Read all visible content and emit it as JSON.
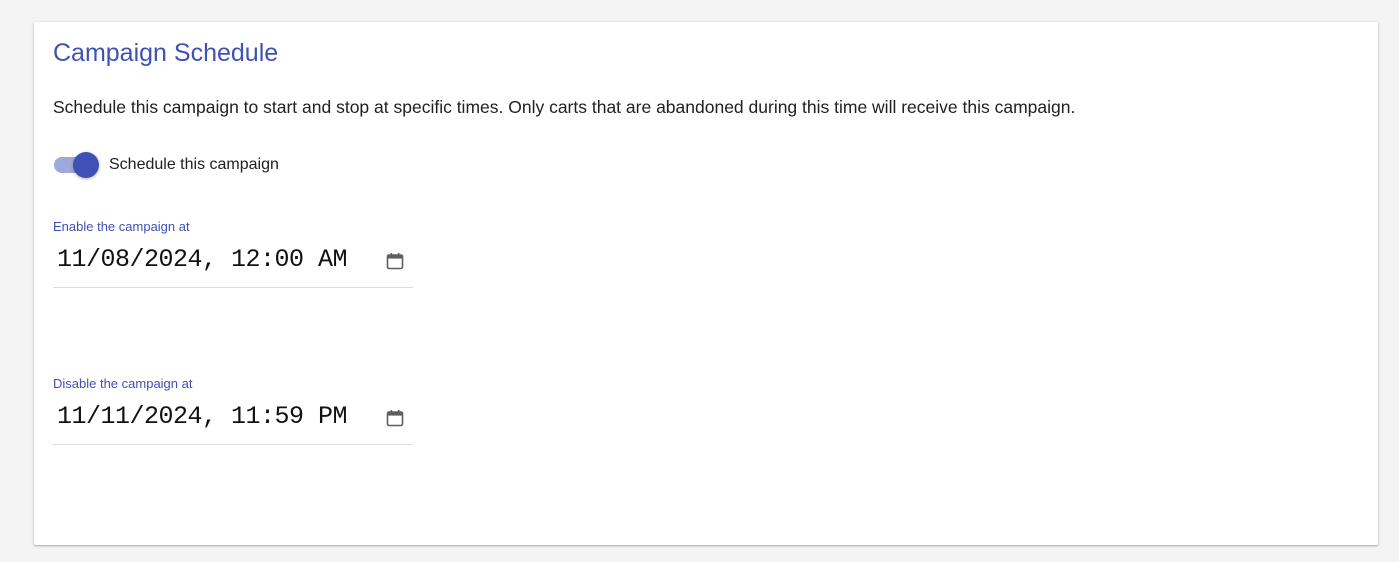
{
  "card": {
    "title": "Campaign Schedule",
    "description": "Schedule this campaign to start and stop at specific times. Only carts that are abandoned during this time will receive this campaign."
  },
  "toggle": {
    "label": "Schedule this campaign",
    "checked": true,
    "track_color": "#9fa8da",
    "thumb_color": "#3f51b5"
  },
  "enable_field": {
    "label": "Enable the campaign at",
    "value": "11/08/2024, 12:00 AM",
    "icon": "calendar-icon"
  },
  "disable_field": {
    "label": "Disable the campaign at",
    "value": "11/11/2024, 11:59 PM",
    "icon": "calendar-icon"
  },
  "colors": {
    "accent": "#3f51b5",
    "text": "#212121",
    "background": "#f4f4f4",
    "card": "#ffffff"
  }
}
